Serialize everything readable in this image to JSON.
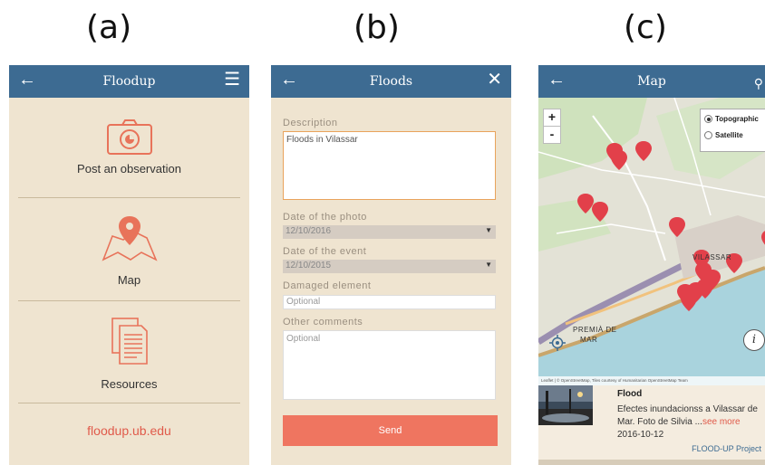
{
  "labels": {
    "a": "(a)",
    "b": "(b)",
    "c": "(c)"
  },
  "colors": {
    "appbar": "#3d6b92",
    "accent": "#e05a4a",
    "send": "#ef7560",
    "background": "#efe4d0"
  },
  "panel_a": {
    "title": "Floodup",
    "back_icon": "←",
    "menu_icon": "☰",
    "items": [
      {
        "label": "Post an observation",
        "icon": "camera-icon"
      },
      {
        "label": "Map",
        "icon": "map-pin-icon"
      },
      {
        "label": "Resources",
        "icon": "document-icon"
      }
    ],
    "link": "floodup.ub.edu"
  },
  "panel_b": {
    "title": "Floods",
    "back_icon": "←",
    "close_icon": "✕",
    "description_label": "Description",
    "description_value": "Floods in Vilassar",
    "photo_date_label": "Date of the photo",
    "photo_date_value": "12/10/2016",
    "event_date_label": "Date of the event",
    "event_date_value": "12/10/2015",
    "damaged_label": "Damaged element",
    "damaged_placeholder": "Optional",
    "comments_label": "Other comments",
    "comments_placeholder": "Optional",
    "send_label": "Send"
  },
  "panel_c": {
    "title": "Map",
    "back_icon": "←",
    "filter_icon": "⚲",
    "zoom_in": "+",
    "zoom_out": "-",
    "layer_topographic": "Topographic",
    "layer_satellite": "Satellite",
    "place_premia": "PREMIÀ DE",
    "place_mar": "MAR",
    "place_vilassar": "VILASSAR",
    "attribution": "Leaflet | © OpenStreetMap, Tiles courtesy of Humanitarian OpenStreetMap Team",
    "info_icon": "i",
    "popup": {
      "title": "Flood",
      "desc": "Efectes inundacionss a Vilassar de Mar. Foto de Silvia ...",
      "see_more": "see more",
      "date": "2016-10-12",
      "project": "FLOOD-UP Project"
    }
  }
}
